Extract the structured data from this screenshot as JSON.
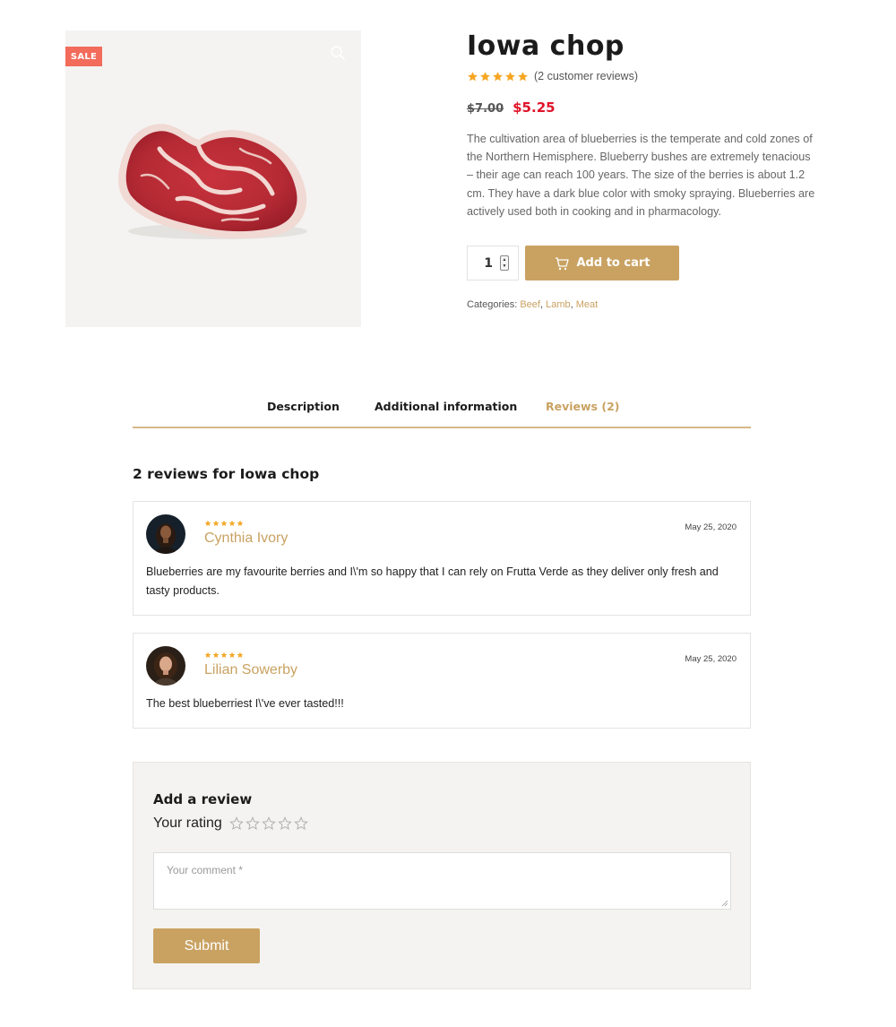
{
  "product": {
    "sale_badge": "SALE",
    "title": "Iowa chop",
    "rating_stars": 5,
    "review_count_text": "(2 customer reviews)",
    "price_old": "$7.00",
    "price_new": "$5.25",
    "description": "The cultivation area of blueberries is the temperate and cold zones of the Northern Hemisphere. Blueberry bushes are extremely tenacious – their age can reach 100 years. The size of the berries is about 1.2 cm. They have a dark blue color with smoky spraying. Blueberries are actively used both in cooking and in pharmacology.",
    "quantity": "1",
    "add_to_cart_label": "Add to cart",
    "categories_label": "Categories:",
    "categories": [
      "Beef",
      "Lamb",
      "Meat"
    ]
  },
  "tabs": [
    {
      "label": "Description",
      "active": false
    },
    {
      "label": "Additional information",
      "active": false
    },
    {
      "label": "Reviews (2)",
      "active": true
    }
  ],
  "reviews_title": "2 reviews for Iowa chop",
  "reviews": [
    {
      "name": "Cynthia Ivory",
      "date": "May 25, 2020",
      "stars": 5,
      "text": "Blueberries are my favourite berries and I\\'m so happy that I can rely on Frutta Verde as they deliver only fresh and tasty products."
    },
    {
      "name": "Lilian Sowerby",
      "date": "May 25, 2020",
      "stars": 5,
      "text": "The best blueberriest I\\'ve ever tasted!!!"
    }
  ],
  "add_review": {
    "title": "Add a review",
    "rating_label": "Your rating",
    "comment_placeholder": "Your comment *",
    "submit_label": "Submit"
  },
  "colors": {
    "accent": "#c9a262",
    "sale": "#f26b5b",
    "price_new": "#e0152a",
    "star": "#f5a623"
  },
  "icons": [
    "search-icon",
    "cart-icon",
    "star-icon",
    "star-outline-icon",
    "resize-grip-icon"
  ]
}
